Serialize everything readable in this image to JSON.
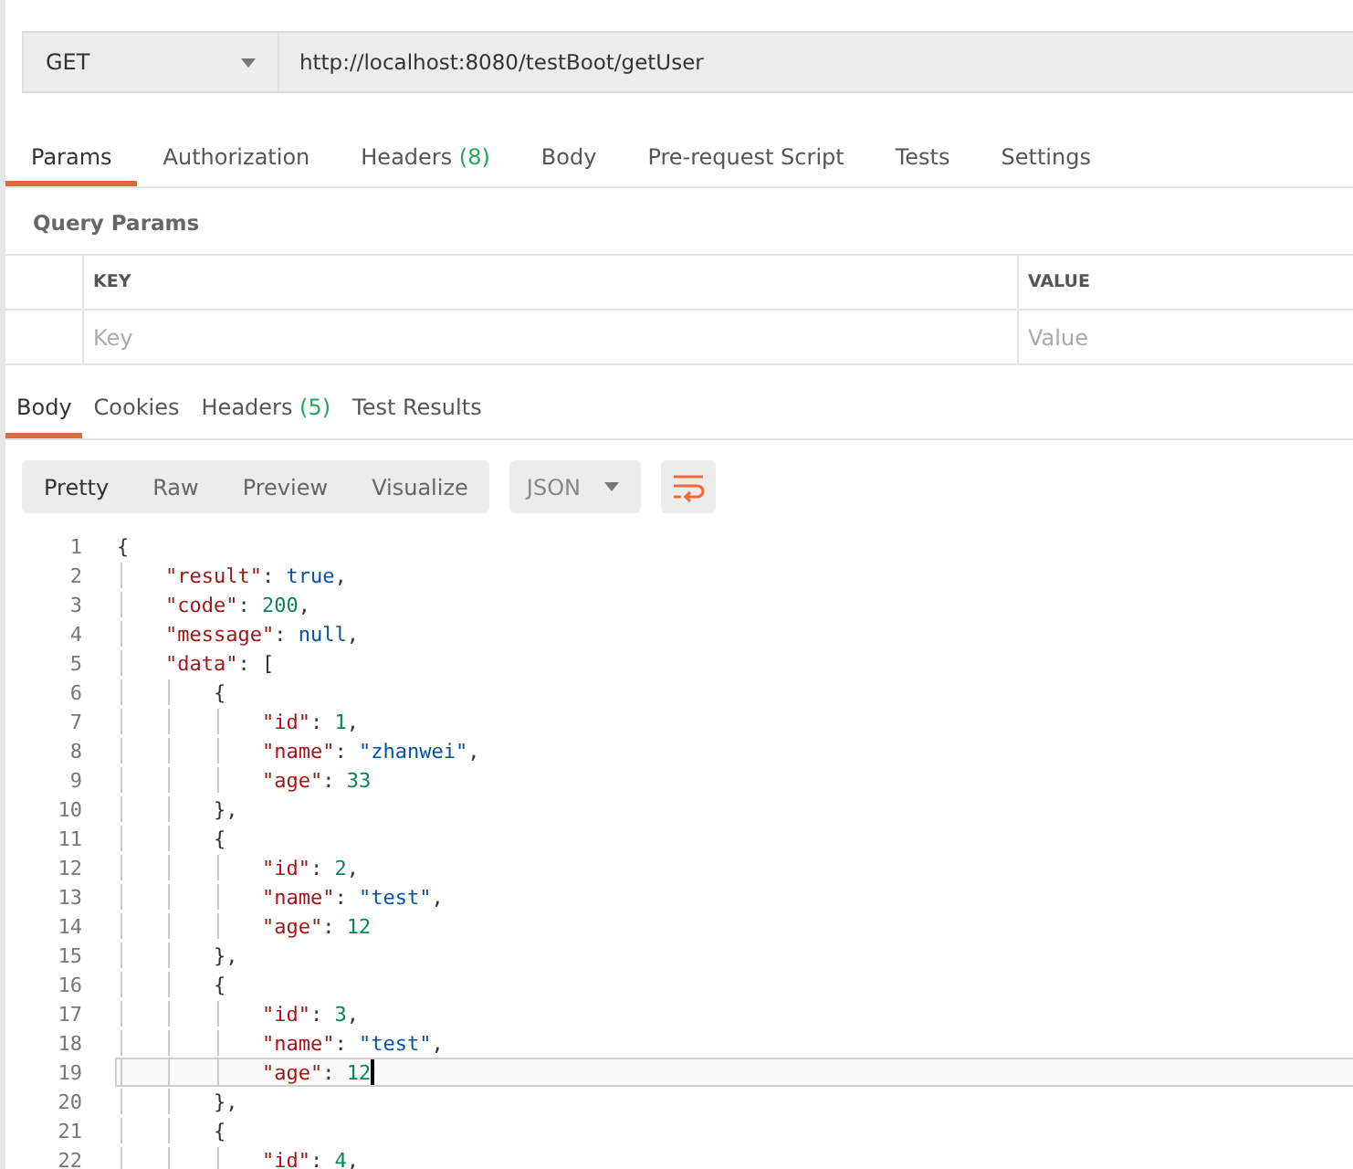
{
  "request": {
    "method": "GET",
    "url": "http://localhost:8080/testBoot/getUser"
  },
  "request_tabs": [
    {
      "label": "Params",
      "selected": true
    },
    {
      "label": "Authorization",
      "selected": false
    },
    {
      "label": "Headers",
      "count": "(8)",
      "selected": false
    },
    {
      "label": "Body",
      "selected": false
    },
    {
      "label": "Pre-request Script",
      "selected": false
    },
    {
      "label": "Tests",
      "selected": false
    },
    {
      "label": "Settings",
      "selected": false
    }
  ],
  "query_params": {
    "title": "Query Params",
    "columns": [
      "KEY",
      "VALUE"
    ],
    "placeholders": [
      "Key",
      "Value"
    ]
  },
  "response_tabs": [
    {
      "label": "Body",
      "selected": true
    },
    {
      "label": "Cookies",
      "selected": false
    },
    {
      "label": "Headers",
      "count": "(5)",
      "selected": false
    },
    {
      "label": "Test Results",
      "selected": false
    }
  ],
  "view_modes": [
    {
      "label": "Pretty",
      "selected": true
    },
    {
      "label": "Raw",
      "selected": false
    },
    {
      "label": "Preview",
      "selected": false
    },
    {
      "label": "Visualize",
      "selected": false
    }
  ],
  "format": "JSON",
  "code_lines": [
    {
      "number": "1",
      "text": "{",
      "current": false
    },
    {
      "number": "2",
      "text": "    \"result\": true,",
      "current": false
    },
    {
      "number": "3",
      "text": "    \"code\": 200,",
      "current": false
    },
    {
      "number": "4",
      "text": "    \"message\": null,",
      "current": false
    },
    {
      "number": "5",
      "text": "    \"data\": [",
      "current": false
    },
    {
      "number": "6",
      "text": "        {",
      "current": false
    },
    {
      "number": "7",
      "text": "            \"id\": 1,",
      "current": false
    },
    {
      "number": "8",
      "text": "            \"name\": \"zhanwei\",",
      "current": false
    },
    {
      "number": "9",
      "text": "            \"age\": 33",
      "current": false
    },
    {
      "number": "10",
      "text": "        },",
      "current": false
    },
    {
      "number": "11",
      "text": "        {",
      "current": false
    },
    {
      "number": "12",
      "text": "            \"id\": 2,",
      "current": false
    },
    {
      "number": "13",
      "text": "            \"name\": \"test\",",
      "current": false
    },
    {
      "number": "14",
      "text": "            \"age\": 12",
      "current": false
    },
    {
      "number": "15",
      "text": "        },",
      "current": false
    },
    {
      "number": "16",
      "text": "        {",
      "current": false
    },
    {
      "number": "17",
      "text": "            \"id\": 3,",
      "current": false
    },
    {
      "number": "18",
      "text": "            \"name\": \"test\",",
      "current": false
    },
    {
      "number": "19",
      "text": "            \"age\": 12",
      "current": true
    },
    {
      "number": "20",
      "text": "        },",
      "current": false
    },
    {
      "number": "21",
      "text": "        {",
      "current": false
    },
    {
      "number": "22",
      "text": "            \"id\": 4,",
      "current": false
    }
  ]
}
